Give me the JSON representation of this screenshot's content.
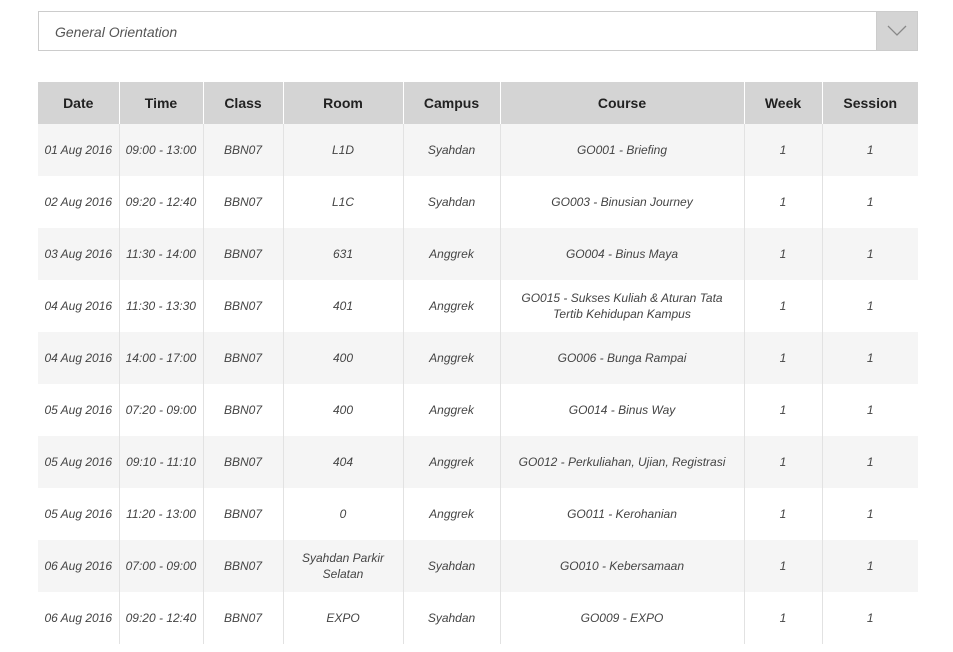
{
  "dropdown": {
    "selected": "General Orientation",
    "icon": "chevron-down-icon"
  },
  "table": {
    "headers": [
      "Date",
      "Time",
      "Class",
      "Room",
      "Campus",
      "Course",
      "Week",
      "Session"
    ],
    "rows": [
      [
        "01 Aug 2016",
        "09:00 - 13:00",
        "BBN07",
        "L1D",
        "Syahdan",
        "GO001 - Briefing",
        "1",
        "1"
      ],
      [
        "02 Aug 2016",
        "09:20 - 12:40",
        "BBN07",
        "L1C",
        "Syahdan",
        "GO003 - Binusian Journey",
        "1",
        "1"
      ],
      [
        "03 Aug 2016",
        "11:30 - 14:00",
        "BBN07",
        "631",
        "Anggrek",
        "GO004 - Binus Maya",
        "1",
        "1"
      ],
      [
        "04 Aug 2016",
        "11:30 - 13:30",
        "BBN07",
        "401",
        "Anggrek",
        "GO015 - Sukses Kuliah & Aturan Tata Tertib Kehidupan Kampus",
        "1",
        "1"
      ],
      [
        "04 Aug 2016",
        "14:00 - 17:00",
        "BBN07",
        "400",
        "Anggrek",
        "GO006 - Bunga Rampai",
        "1",
        "1"
      ],
      [
        "05 Aug 2016",
        "07:20 - 09:00",
        "BBN07",
        "400",
        "Anggrek",
        "GO014 - Binus Way",
        "1",
        "1"
      ],
      [
        "05 Aug 2016",
        "09:10 - 11:10",
        "BBN07",
        "404",
        "Anggrek",
        "GO012 - Perkuliahan, Ujian, Registrasi",
        "1",
        "1"
      ],
      [
        "05 Aug 2016",
        "11:20 - 13:00",
        "BBN07",
        "0",
        "Anggrek",
        "GO011 - Kerohanian",
        "1",
        "1"
      ],
      [
        "06 Aug 2016",
        "07:00 - 09:00",
        "BBN07",
        "Syahdan Parkir Selatan",
        "Syahdan",
        "GO010 - Kebersamaan",
        "1",
        "1"
      ],
      [
        "06 Aug 2016",
        "09:20 - 12:40",
        "BBN07",
        "EXPO",
        "Syahdan",
        "GO009 - EXPO",
        "1",
        "1"
      ]
    ]
  }
}
